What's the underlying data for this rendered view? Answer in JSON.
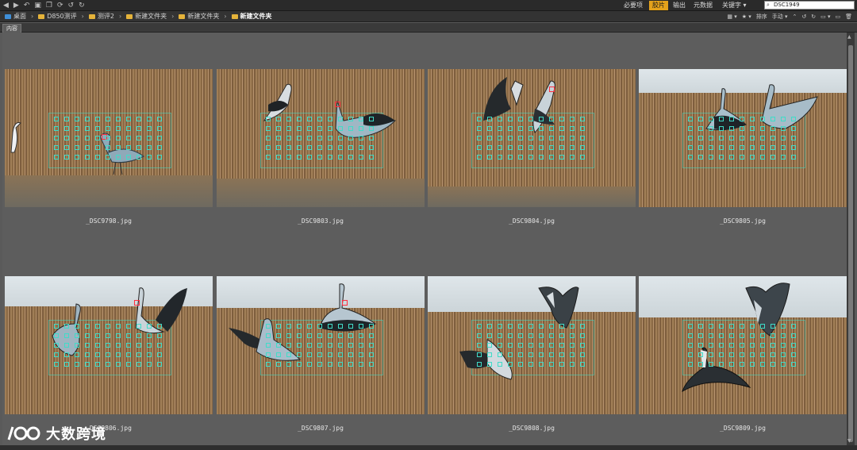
{
  "toolbar": {
    "icons": [
      "back-icon",
      "forward-icon",
      "rotate-icon",
      "camera-icon",
      "copy-icon",
      "refresh-icon",
      "undo-icon",
      "redo-icon"
    ],
    "workspaces": [
      {
        "label": "必要项",
        "active": false
      },
      {
        "label": "胶片",
        "active": true
      },
      {
        "label": "输出",
        "active": false
      },
      {
        "label": "元数据",
        "active": false
      },
      {
        "label": "关键字 ▾",
        "active": false
      }
    ],
    "search_value": "DSC1949",
    "accent": "#e4a21b"
  },
  "path": {
    "items": [
      "桌面",
      "D850测评",
      "测评2",
      "新建文件夹",
      "新建文件夹",
      "新建文件夹"
    ]
  },
  "pathbar_right": {
    "sort_label": "排序",
    "sort_value": "手动 ▾"
  },
  "content_tab": "内容",
  "thumbnails": [
    {
      "file": "_DSC9798.jpg"
    },
    {
      "file": "_DSC9803.jpg"
    },
    {
      "file": "_DSC9804.jpg"
    },
    {
      "file": "_DSC9805.jpg"
    },
    {
      "file": "_DSC9806.jpg"
    },
    {
      "file": "_DSC9807.jpg"
    },
    {
      "file": "_DSC9808.jpg"
    },
    {
      "file": "_DSC9809.jpg"
    }
  ],
  "watermark": {
    "logo": "100",
    "text": "大数跨境"
  }
}
